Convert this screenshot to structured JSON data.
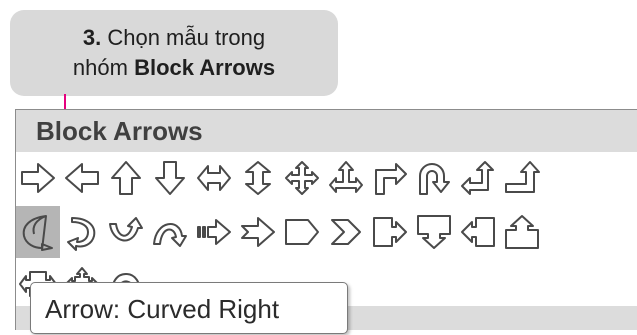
{
  "callout": {
    "step": "3.",
    "line1_rest": " Chọn mẫu trong",
    "line2_prefix": "nhóm ",
    "line2_bold": "Block Arrows"
  },
  "panel": {
    "title": "Block Arrows"
  },
  "shapes_row1": [
    "arrow-right-icon",
    "arrow-left-icon",
    "arrow-up-icon",
    "arrow-down-icon",
    "arrow-left-right-icon",
    "arrow-up-down-icon",
    "arrow-quad-icon",
    "arrow-left-right-up-icon",
    "arrow-bent-icon",
    "arrow-u-turn-icon",
    "arrow-left-up-icon",
    "arrow-bent-up-icon"
  ],
  "shapes_row2": [
    "arrow-curved-right-icon",
    "arrow-curved-left-icon",
    "arrow-curved-up-icon",
    "arrow-curved-down-icon",
    "arrow-striped-right-icon",
    "arrow-notched-right-icon",
    "pentagon-icon",
    "chevron-icon",
    "callout-right-arrow-icon",
    "callout-down-arrow-icon",
    "callout-left-arrow-icon",
    "callout-up-arrow-icon"
  ],
  "shapes_row3": [
    "callout-left-right-arrow-icon",
    "callout-quad-arrow-icon",
    "circular-arrow-icon"
  ],
  "selected_shape": "arrow-curved-right-icon",
  "tooltip": {
    "text": "Arrow: Curved Right"
  },
  "colors": {
    "pointer": "#e6007e",
    "callout_bg": "#d9d9d9",
    "header_bg": "#dcdcdc",
    "selected_bg": "#b5b5b5"
  }
}
